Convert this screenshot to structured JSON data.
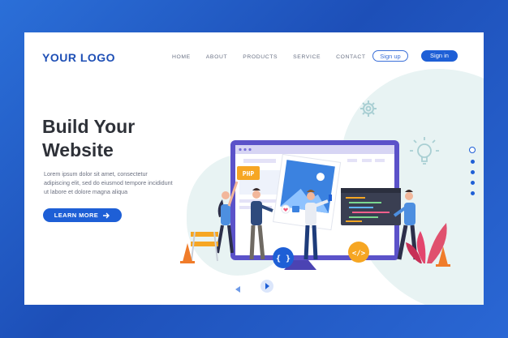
{
  "logo": "YOUR LOGO",
  "nav": {
    "items": [
      "HOME",
      "ABOUT",
      "PRODUCTS",
      "SERVICE",
      "CONTACT"
    ]
  },
  "auth": {
    "signup_label": "Sign up",
    "signin_label": "Sign in"
  },
  "hero": {
    "title_line1": "Build Your",
    "title_line2": "Website",
    "description": "Lorem ipsum dolor sit amet, consectetur adipiscing elit, sed do eiusmod tempore incididunt ut labore et dolore magna aliqua",
    "cta_label": "LEARN MORE",
    "cta_icon": "arrow-right-icon"
  },
  "illustration": {
    "php_badge": "PHP",
    "code_badge": "</>",
    "braces_badge": "{ }"
  },
  "pagination": {
    "count": 5,
    "active_index": 0
  },
  "colors": {
    "brand": "#1e5fd6",
    "logo": "#1e4fb5",
    "heading": "#2e3138",
    "accent_orange": "#f6a623"
  }
}
